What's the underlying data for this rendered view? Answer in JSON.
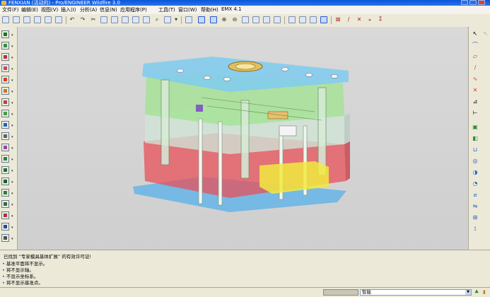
{
  "window": {
    "title": "FENXIAN (活动的) - Pro/ENGINEER Wildfire 3.0"
  },
  "menu": [
    "文件(F)",
    "编辑(E)",
    "视图(V)",
    "插入(I)",
    "分析(A)",
    "信息(N)",
    "应用程序(P)",
    "工具(T)",
    "窗口(W)",
    "帮助(H)",
    "EMX 4.1"
  ],
  "messages": [
    {
      "bullet": "",
      "text": "已找到 “专家模具基体扩展” 的有效许可证!"
    },
    {
      "bullet": "•",
      "text": "基准平面将不显示。"
    },
    {
      "bullet": "•",
      "text": "将不显示轴。"
    },
    {
      "bullet": "•",
      "text": "不显示坐标系。"
    },
    {
      "bullet": "•",
      "text": "将不显示基准点。"
    }
  ],
  "status": {
    "filter_value": "智能"
  },
  "colors": {
    "plate_blue": "#7fcbf0",
    "plate_green": "#9ce48a",
    "plate_red": "#e8505a",
    "plate_bottom": "#6bb6e6"
  }
}
